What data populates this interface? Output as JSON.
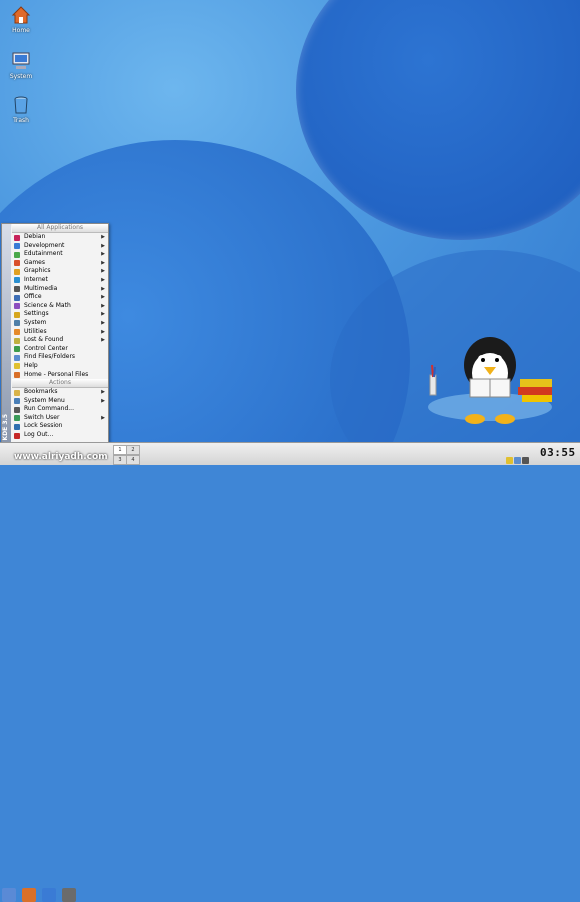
{
  "desktop": {
    "icons": [
      {
        "label": "Home"
      },
      {
        "label": "System"
      },
      {
        "label": "Trash"
      }
    ]
  },
  "menu": {
    "side_label": "KDE 3.5",
    "header_all": "All Applications",
    "header_actions": "Actions",
    "apps": [
      {
        "label": "Debian",
        "icon_color": "#c7235a",
        "sub": true
      },
      {
        "label": "Development",
        "icon_color": "#3a7bd5",
        "sub": true
      },
      {
        "label": "Edutainment",
        "icon_color": "#4aa84a",
        "sub": true
      },
      {
        "label": "Games",
        "icon_color": "#d94f2b",
        "sub": true
      },
      {
        "label": "Graphics",
        "icon_color": "#e0a020",
        "sub": true
      },
      {
        "label": "Internet",
        "icon_color": "#2a8fd0",
        "sub": true
      },
      {
        "label": "Multimedia",
        "icon_color": "#555555",
        "sub": true
      },
      {
        "label": "Office",
        "icon_color": "#3c6db5",
        "sub": true
      },
      {
        "label": "Science & Math",
        "icon_color": "#8c4fbf",
        "sub": true
      },
      {
        "label": "Settings",
        "icon_color": "#d6a61d",
        "sub": true
      },
      {
        "label": "System",
        "icon_color": "#4f7fa8",
        "sub": true
      },
      {
        "label": "Utilities",
        "icon_color": "#e58a2a",
        "sub": true
      },
      {
        "label": "Lost & Found",
        "icon_color": "#c0b040",
        "sub": true
      },
      {
        "label": "Control Center",
        "icon_color": "#3d9b4b",
        "sub": false
      },
      {
        "label": "Find Files/Folders",
        "icon_color": "#5b8dcf",
        "sub": false
      },
      {
        "label": "Help",
        "icon_color": "#e0c030",
        "sub": false
      },
      {
        "label": "Home - Personal Files",
        "icon_color": "#d9702a",
        "sub": false
      }
    ],
    "actions": [
      {
        "label": "Bookmarks",
        "icon_color": "#d8b34a",
        "sub": true
      },
      {
        "label": "System Menu",
        "icon_color": "#4a7fb8",
        "sub": true
      },
      {
        "label": "Run Command...",
        "icon_color": "#5a5a5a",
        "sub": false
      },
      {
        "label": "Switch User",
        "icon_color": "#3b9b5a",
        "sub": true
      },
      {
        "label": "Lock Session",
        "icon_color": "#2f6fb0",
        "sub": false
      },
      {
        "label": "Log Out...",
        "icon_color": "#c62828",
        "sub": false
      }
    ]
  },
  "panel": {
    "pager": [
      "1",
      "2",
      "3",
      "4"
    ],
    "clock": "03:55"
  },
  "watermark": "www.alriyadh.com"
}
